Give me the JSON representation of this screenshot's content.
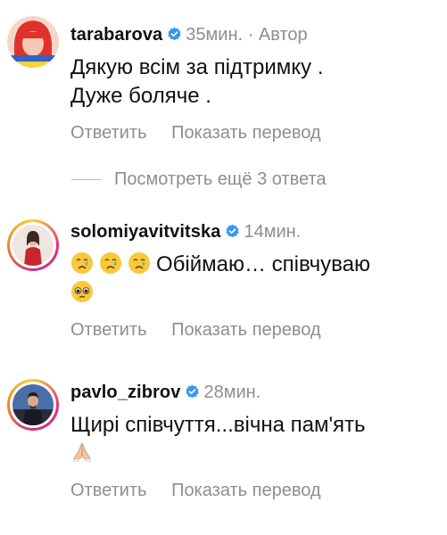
{
  "comments": [
    {
      "username": "tarabarova",
      "verified": true,
      "time": "35мин.",
      "separator": "·",
      "tag": "Автор",
      "lines": [
        "Дякую всім за підтримку .",
        "Дуже боляче ."
      ],
      "reply_label": "Ответить",
      "translate_label": "Показать перевод"
    },
    {
      "username": "solomiyavitvitska",
      "verified": true,
      "time": "14мин.",
      "emoji_lead": [
        "crying-face",
        "crying-face",
        "crying-face"
      ],
      "text": "Обіймаю… співчуваю",
      "emoji_trail": [
        "pleading-face"
      ],
      "reply_label": "Ответить",
      "translate_label": "Показать перевод"
    },
    {
      "username": "pavlo_zibrov",
      "verified": true,
      "time": "28мин.",
      "text": "Щирі співчуття...вічна пам'ять",
      "emoji_trail": [
        "folded-hands"
      ],
      "reply_label": "Ответить",
      "translate_label": "Показать перевод"
    }
  ],
  "view_more_replies": "Посмотреть ещё 3 ответа",
  "colors": {
    "verified_badge": "#3897f0",
    "secondary_text": "#8e8e8e",
    "primary_text": "#111111"
  }
}
